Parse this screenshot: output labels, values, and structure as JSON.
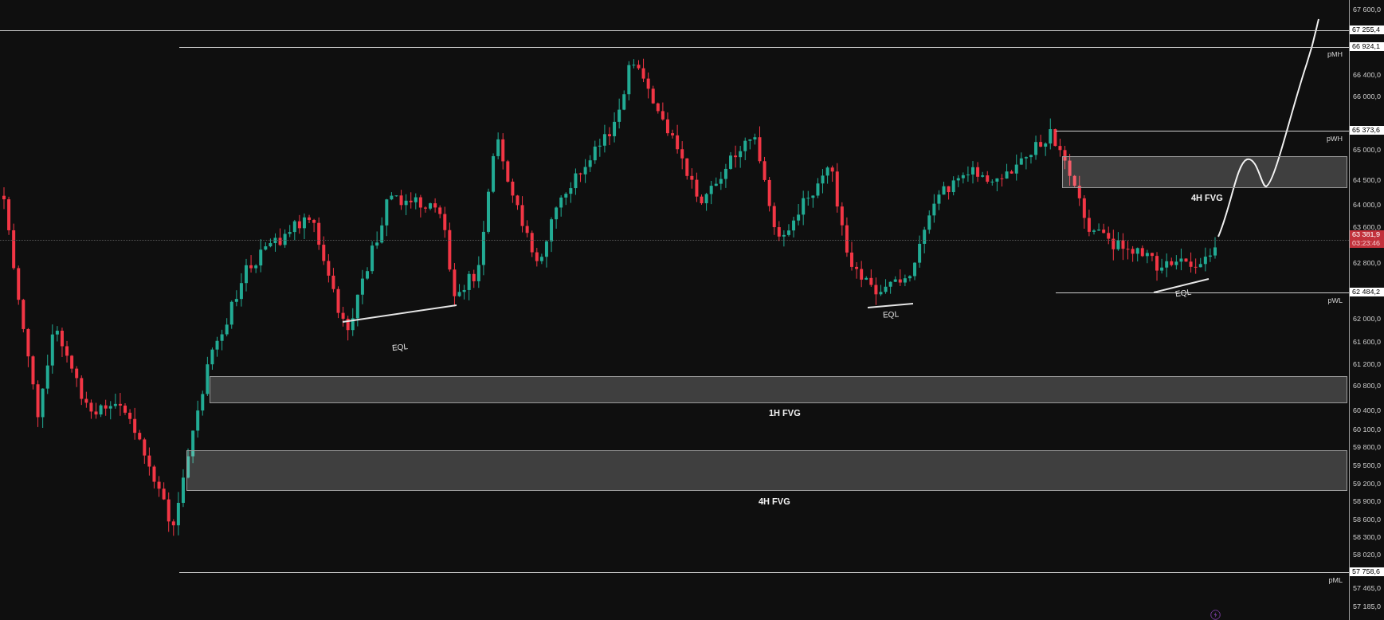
{
  "chart": {
    "price_axis": {
      "labels": [
        "67 600,0",
        "66 400,0",
        "66 000,0",
        "65 000,0",
        "64 500,0",
        "64 000,0",
        "63 600,0",
        "62 800,0",
        "62 000,0",
        "61 600,0",
        "61 200,0",
        "60 800,0",
        "60 400,0",
        "60 100,0",
        "59 800,0",
        "59 500,0",
        "59 200,0",
        "58 900,0",
        "58 600,0",
        "58 300,0",
        "58 020,0",
        "57 465,0",
        "57 185,0"
      ]
    },
    "levels": [
      {
        "price": "67 255,4"
      },
      {
        "price": "66 924,1",
        "label": "pMH"
      },
      {
        "price": "65 373,6",
        "label": "pWH"
      },
      {
        "price": "62 484,2",
        "label": "pWL"
      },
      {
        "price": "57 758,6",
        "label": "pML"
      }
    ],
    "current_price": {
      "price": "63 381,9",
      "countdown": "03:23:46"
    },
    "zones": [
      {
        "label": "4H FVG"
      },
      {
        "label": "1H FVG"
      },
      {
        "label": "4H FVG"
      }
    ],
    "annotations": [
      {
        "label": "EQL"
      },
      {
        "label": "EQL"
      },
      {
        "label": "EQL"
      }
    ]
  }
}
